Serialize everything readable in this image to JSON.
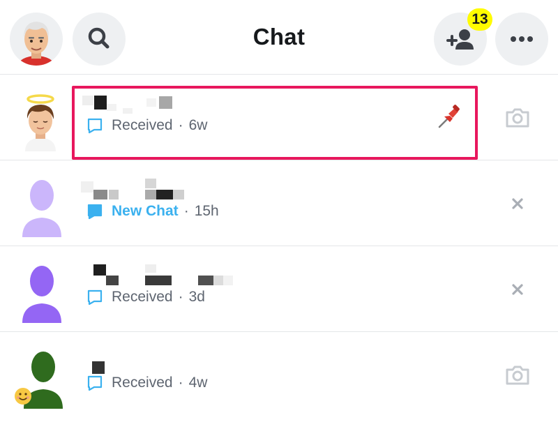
{
  "header": {
    "title": "Chat",
    "friend_requests_badge": "13",
    "icons": {
      "profile": "bitmoji-avatar",
      "search": "search-icon",
      "add_friend": "add-friend-icon",
      "more": "more-icon"
    }
  },
  "chats": [
    {
      "name": "",
      "status": "Received",
      "separator": "·",
      "time": "6w",
      "status_icon": "chat-outline-icon",
      "right_action": "camera-icon",
      "pinned": true,
      "avatar": "bitmoji-halo"
    },
    {
      "name": "",
      "status": "New Chat",
      "separator": "·",
      "time": "15h",
      "status_icon": "chat-filled-icon",
      "right_action": "close-icon",
      "pinned": false,
      "avatar": "placeholder-light-purple"
    },
    {
      "name": "",
      "status": "Received",
      "separator": "·",
      "time": "3d",
      "status_icon": "chat-outline-icon",
      "right_action": "close-icon",
      "pinned": false,
      "avatar": "placeholder-purple"
    },
    {
      "name": "",
      "status": "Received",
      "separator": "·",
      "time": "4w",
      "status_icon": "chat-outline-icon",
      "right_action": "camera-icon",
      "pinned": false,
      "avatar": "placeholder-green-with-emoji"
    }
  ],
  "colors": {
    "accent_blue": "#3bb1ef",
    "badge_yellow": "#fffc00",
    "highlight_pink": "#e8175d",
    "muted_text": "#5e6570",
    "icon_gray": "#c7cbd0"
  }
}
